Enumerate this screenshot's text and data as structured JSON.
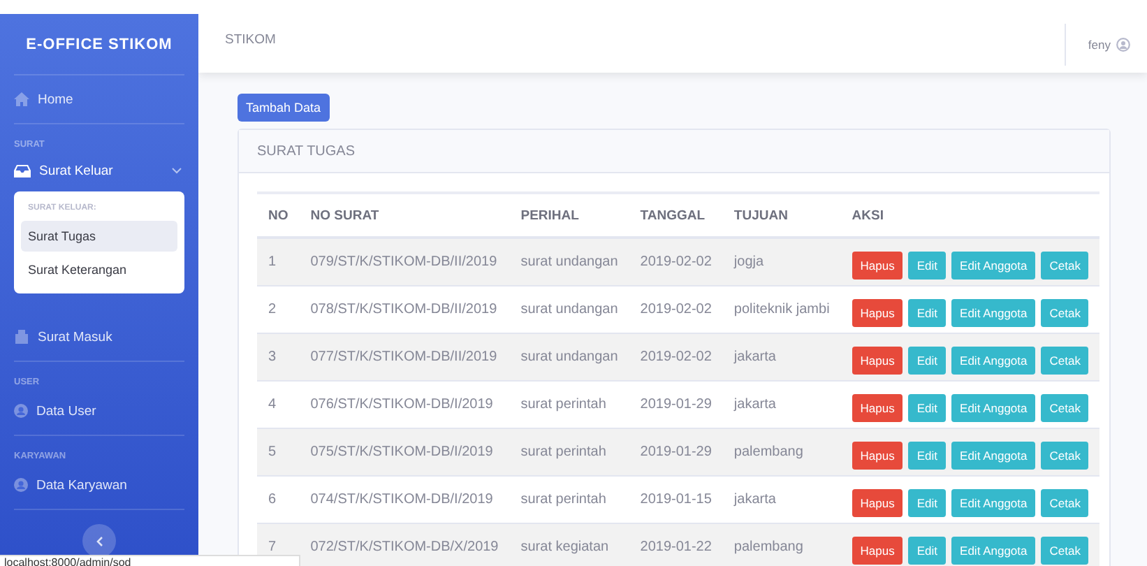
{
  "sidebar": {
    "brand": "E-OFFICE STIKOM",
    "items": [
      {
        "kind": "link",
        "label": "Home"
      },
      {
        "kind": "heading",
        "label": "SURAT"
      },
      {
        "kind": "group",
        "label": "Surat Keluar",
        "expanded": true,
        "submenu": {
          "heading": "SURAT KELUAR:",
          "items": [
            {
              "label": "Surat Tugas",
              "selected": true
            },
            {
              "label": "Surat Keterangan",
              "selected": false
            }
          ]
        }
      },
      {
        "kind": "link",
        "label": "Surat Masuk"
      },
      {
        "kind": "heading",
        "label": "USER"
      },
      {
        "kind": "link",
        "label": "Data User"
      },
      {
        "kind": "heading",
        "label": "KARYAWAN"
      },
      {
        "kind": "link",
        "label": "Data Karyawan"
      }
    ]
  },
  "topbar": {
    "title": "STIKOM",
    "user": "feny"
  },
  "content": {
    "add_button": "Tambah Data",
    "card_title": "SURAT TUGAS",
    "table": {
      "columns": [
        "NO",
        "NO SURAT",
        "PERIHAL",
        "TANGGAL",
        "TUJUAN",
        "AKSI"
      ],
      "rows": [
        {
          "cells": [
            "1",
            "079/ST/K/STIKOM-DB/II/2019",
            "surat undangan",
            "2019-02-02",
            "jogja"
          ],
          "actions": [
            {
              "kind": "danger",
              "label": "Hapus"
            },
            {
              "kind": "info",
              "label": "Edit"
            },
            {
              "kind": "info",
              "label": "Edit Anggota"
            },
            {
              "kind": "info",
              "label": "Cetak"
            }
          ]
        },
        {
          "cells": [
            "2",
            "078/ST/K/STIKOM-DB/II/2019",
            "surat undangan",
            "2019-02-02",
            "politeknik jambi"
          ],
          "actions": [
            {
              "kind": "danger",
              "label": "Hapus"
            },
            {
              "kind": "info",
              "label": "Edit"
            },
            {
              "kind": "info",
              "label": "Edit Anggota"
            },
            {
              "kind": "info",
              "label": "Cetak"
            }
          ]
        },
        {
          "cells": [
            "3",
            "077/ST/K/STIKOM-DB/II/2019",
            "surat undangan",
            "2019-02-02",
            "jakarta"
          ],
          "actions": [
            {
              "kind": "danger",
              "label": "Hapus"
            },
            {
              "kind": "info",
              "label": "Edit"
            },
            {
              "kind": "info",
              "label": "Edit Anggota"
            },
            {
              "kind": "info",
              "label": "Cetak"
            }
          ]
        },
        {
          "cells": [
            "4",
            "076/ST/K/STIKOM-DB/I/2019",
            "surat perintah",
            "2019-01-29",
            "jakarta"
          ],
          "actions": [
            {
              "kind": "danger",
              "label": "Hapus"
            },
            {
              "kind": "info",
              "label": "Edit"
            },
            {
              "kind": "info",
              "label": "Edit Anggota"
            },
            {
              "kind": "info",
              "label": "Cetak"
            }
          ]
        },
        {
          "cells": [
            "5",
            "075/ST/K/STIKOM-DB/I/2019",
            "surat perintah",
            "2019-01-29",
            "palembang"
          ],
          "actions": [
            {
              "kind": "danger",
              "label": "Hapus"
            },
            {
              "kind": "info",
              "label": "Edit"
            },
            {
              "kind": "info",
              "label": "Edit Anggota"
            },
            {
              "kind": "info",
              "label": "Cetak"
            }
          ]
        },
        {
          "cells": [
            "6",
            "074/ST/K/STIKOM-DB/I/2019",
            "surat perintah",
            "2019-01-15",
            "jakarta"
          ],
          "actions": [
            {
              "kind": "danger",
              "label": "Hapus"
            },
            {
              "kind": "info",
              "label": "Edit"
            },
            {
              "kind": "info",
              "label": "Edit Anggota"
            },
            {
              "kind": "info",
              "label": "Cetak"
            }
          ]
        },
        {
          "cells": [
            "7",
            "072/ST/K/STIKOM-DB/X/2019",
            "surat kegiatan",
            "2019-01-22",
            "palembang"
          ],
          "actions": [
            {
              "kind": "danger",
              "label": "Hapus"
            },
            {
              "kind": "info",
              "label": "Edit"
            },
            {
              "kind": "info",
              "label": "Edit Anggota"
            },
            {
              "kind": "info",
              "label": "Cetak"
            }
          ]
        }
      ]
    }
  },
  "status_bar": "localhost:8000/admin/sod"
}
